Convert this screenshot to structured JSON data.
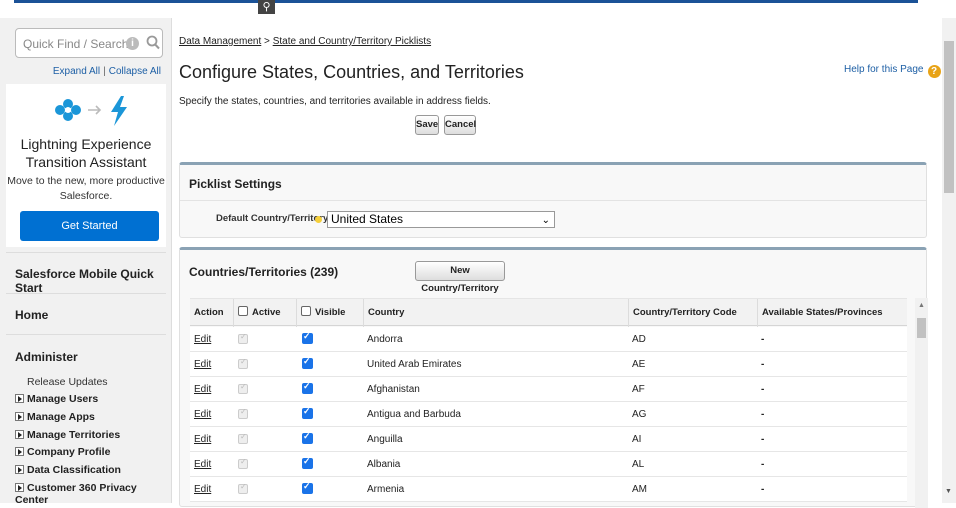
{
  "search": {
    "placeholder": "Quick Find / Search..."
  },
  "sidebar": {
    "expand_all": "Expand All",
    "separator": "|",
    "collapse_all": "Collapse All",
    "lightning": {
      "title_line1": "Lightning Experience",
      "title_line2": "Transition Assistant",
      "desc_line1": "Move to the new, more productive",
      "desc_line2": "Salesforce.",
      "button": "Get Started"
    },
    "mobile_quick_start": "Salesforce Mobile Quick Start",
    "home": "Home",
    "administer": "Administer",
    "release_updates": "Release Updates",
    "nav_items": [
      "Manage Users",
      "Manage Apps",
      "Manage Territories",
      "Company Profile",
      "Data Classification",
      "Customer 360 Privacy Center"
    ]
  },
  "breadcrumb": {
    "part1": "Data Management",
    "sep": " > ",
    "part2": "State and Country/Territory Picklists"
  },
  "page": {
    "title": "Configure States, Countries, and Territories",
    "help": "Help for this Page",
    "description": "Specify the states, countries, and territories available in address fields.",
    "save": "Save",
    "cancel": "Cancel"
  },
  "picklist_settings": {
    "heading": "Picklist Settings",
    "default_label": "Default Country/Territory",
    "default_value": "United States"
  },
  "countries": {
    "heading": "Countries/Territories (239)",
    "new_button": "New Country/Territory",
    "columns": {
      "action": "Action",
      "active": "Active",
      "visible": "Visible",
      "country": "Country",
      "code": "Country/Territory Code",
      "states": "Available States/Provinces"
    },
    "rows": [
      {
        "action": "Edit",
        "country": "Andorra",
        "code": "AD",
        "states": "-"
      },
      {
        "action": "Edit",
        "country": "United Arab Emirates",
        "code": "AE",
        "states": "-"
      },
      {
        "action": "Edit",
        "country": "Afghanistan",
        "code": "AF",
        "states": "-"
      },
      {
        "action": "Edit",
        "country": "Antigua and Barbuda",
        "code": "AG",
        "states": "-"
      },
      {
        "action": "Edit",
        "country": "Anguilla",
        "code": "AI",
        "states": "-"
      },
      {
        "action": "Edit",
        "country": "Albania",
        "code": "AL",
        "states": "-"
      },
      {
        "action": "Edit",
        "country": "Armenia",
        "code": "AM",
        "states": "-"
      }
    ]
  },
  "colors": {
    "accent_blue": "#0070d2",
    "checkbox_blue": "#1a73e8"
  }
}
